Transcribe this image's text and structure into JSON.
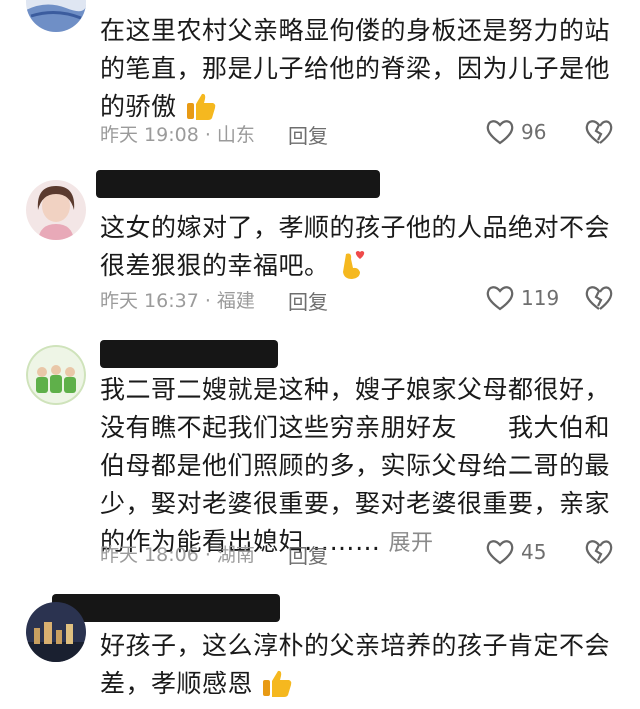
{
  "comments": [
    {
      "text": "在这里农村父亲略显佝偻的身板还是努力的站的笔直，那是儿子给他的脊梁，因为儿子是他的骄傲",
      "emoji": "thumbs-up-icon",
      "time": "昨天 19:08 · 山东",
      "reply": "回复",
      "likes": "96"
    },
    {
      "text": "这女的嫁对了，孝顺的孩子他的人品绝对不会很差狠狠的幸福吧。",
      "emoji": "finger-heart-icon",
      "time": "昨天 16:37 · 福建",
      "reply": "回复",
      "likes": "119"
    },
    {
      "text": "我二哥二嫂就是这种，嫂子娘家父母都很好，没有瞧不起我们这些穷亲朋好友　　我大伯和伯母都是他们照顾的多，实际父母给二哥的最少，娶对老婆很重要，娶对老婆很重要，亲家的作为能看出媳妇………",
      "expand": "展开",
      "time": "昨天 18:06 · 湖南",
      "reply": "回复",
      "likes": "45"
    },
    {
      "text": "好孩子，这么淳朴的父亲培养的孩子肯定不会差，孝顺感恩",
      "emoji": "thumbs-up-icon"
    }
  ],
  "colors": {
    "text": "#1a1a1a",
    "meta": "#9b9b9b",
    "redaction": "#161616",
    "thumb": "#f5b81f"
  }
}
